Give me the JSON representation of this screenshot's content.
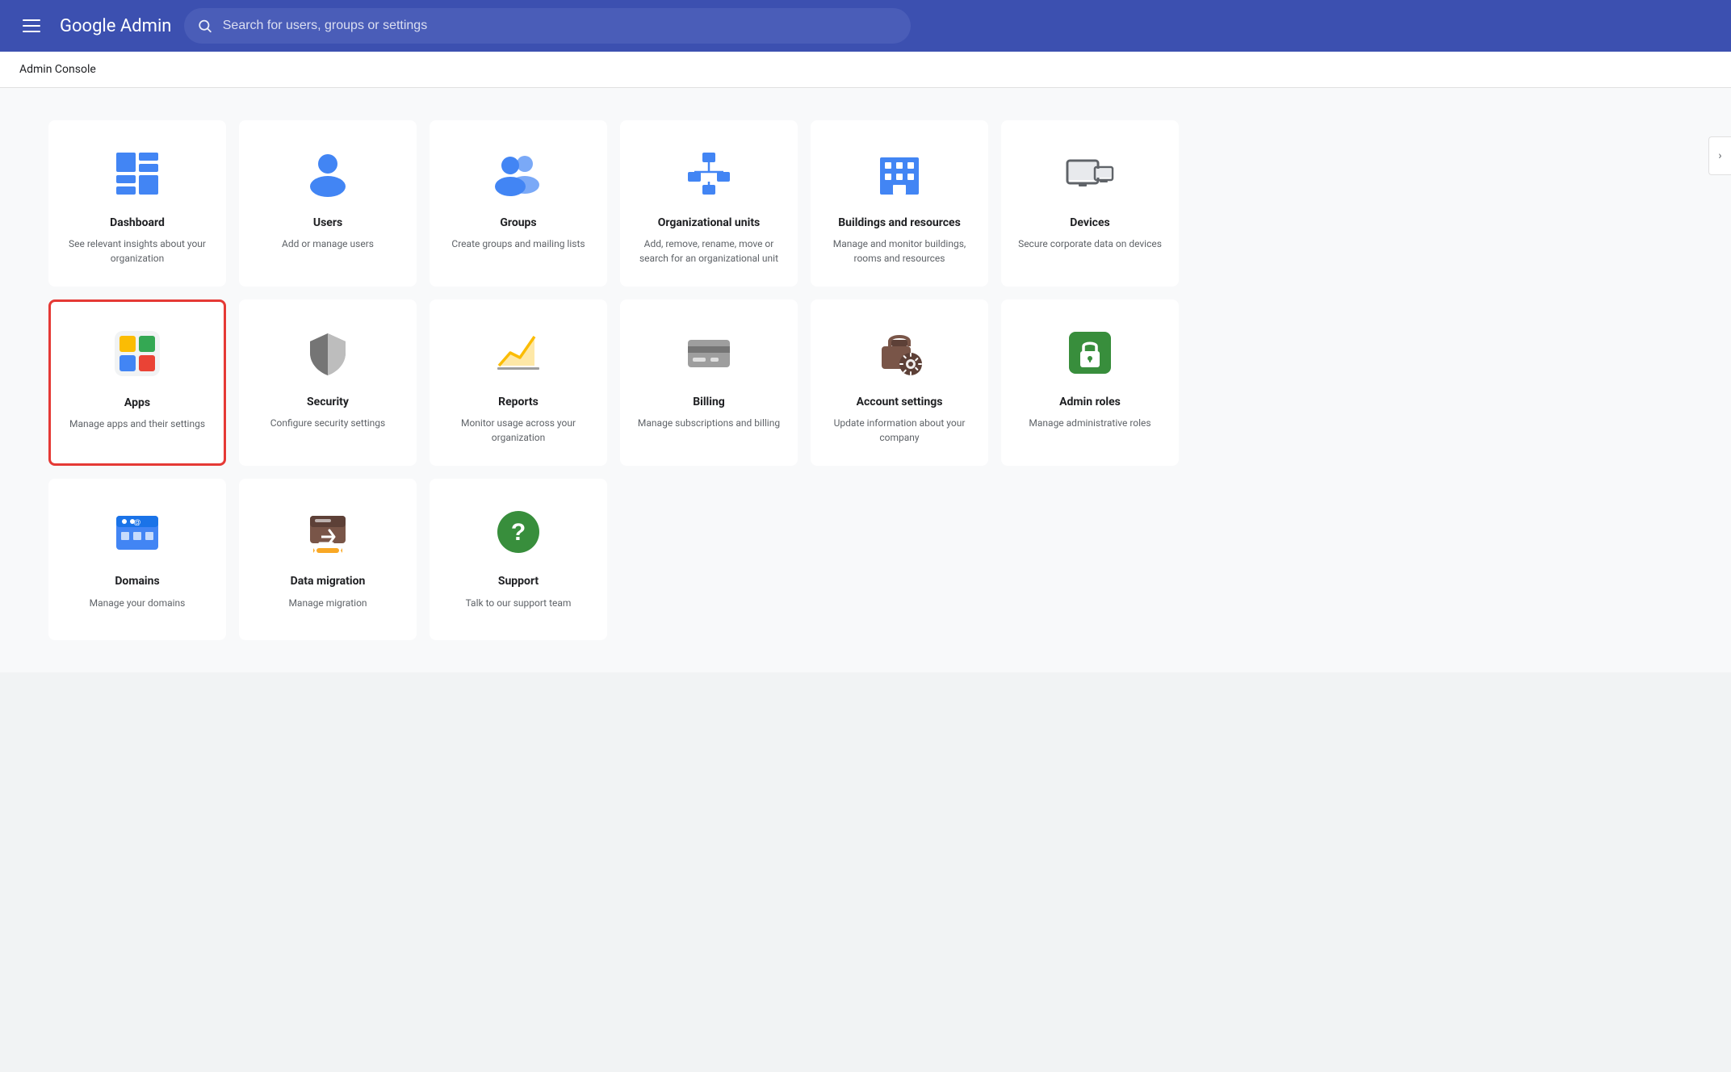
{
  "header": {
    "menu_label": "Menu",
    "logo": "Google Admin",
    "search_placeholder": "Search for users, groups or settings"
  },
  "breadcrumb": "Admin Console",
  "chevron": "›",
  "cards": [
    {
      "id": "dashboard",
      "title": "Dashboard",
      "desc": "See relevant insights about your organization",
      "icon": "dashboard",
      "selected": false,
      "row": 0
    },
    {
      "id": "users",
      "title": "Users",
      "desc": "Add or manage users",
      "icon": "users",
      "selected": false,
      "row": 0
    },
    {
      "id": "groups",
      "title": "Groups",
      "desc": "Create groups and mailing lists",
      "icon": "groups",
      "selected": false,
      "row": 0
    },
    {
      "id": "org-units",
      "title": "Organizational units",
      "desc": "Add, remove, rename, move or search for an organizational unit",
      "icon": "org-units",
      "selected": false,
      "row": 0
    },
    {
      "id": "buildings",
      "title": "Buildings and resources",
      "desc": "Manage and monitor buildings, rooms and resources",
      "icon": "buildings",
      "selected": false,
      "row": 0
    },
    {
      "id": "devices",
      "title": "Devices",
      "desc": "Secure corporate data on devices",
      "icon": "devices",
      "selected": false,
      "row": 0
    },
    {
      "id": "apps",
      "title": "Apps",
      "desc": "Manage apps and their settings",
      "icon": "apps",
      "selected": true,
      "row": 1
    },
    {
      "id": "security",
      "title": "Security",
      "desc": "Configure security settings",
      "icon": "security",
      "selected": false,
      "row": 1
    },
    {
      "id": "reports",
      "title": "Reports",
      "desc": "Monitor usage across your organization",
      "icon": "reports",
      "selected": false,
      "row": 1
    },
    {
      "id": "billing",
      "title": "Billing",
      "desc": "Manage subscriptions and billing",
      "icon": "billing",
      "selected": false,
      "row": 1
    },
    {
      "id": "account-settings",
      "title": "Account settings",
      "desc": "Update information about your company",
      "icon": "account-settings",
      "selected": false,
      "row": 1
    },
    {
      "id": "admin-roles",
      "title": "Admin roles",
      "desc": "Manage administrative roles",
      "icon": "admin-roles",
      "selected": false,
      "row": 1
    },
    {
      "id": "domains",
      "title": "Domains",
      "desc": "Manage your domains",
      "icon": "domains",
      "selected": false,
      "row": 2
    },
    {
      "id": "data-migration",
      "title": "Data migration",
      "desc": "Manage migration",
      "icon": "data-migration",
      "selected": false,
      "row": 2
    },
    {
      "id": "support",
      "title": "Support",
      "desc": "Talk to our support team",
      "icon": "support",
      "selected": false,
      "row": 2
    }
  ]
}
